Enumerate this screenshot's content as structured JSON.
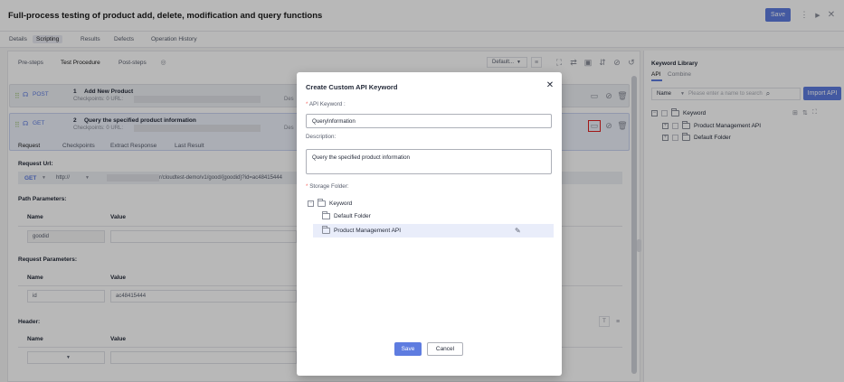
{
  "window": {
    "title": "Full-process testing of product add, delete, modification and query functions",
    "save": "Save"
  },
  "tabs": [
    "Details",
    "Scripting",
    "Results",
    "Defects",
    "Operation History"
  ],
  "subtabs": [
    "Pre-steps",
    "Test Procedure",
    "Post-steps"
  ],
  "toolbar": {
    "env": "Default..."
  },
  "steps": [
    {
      "num": "1",
      "method": "POST",
      "name": "Add New Product",
      "checkpoints": "Checkpoints: 0  URL:",
      "desc": "Des"
    },
    {
      "num": "2",
      "method": "GET",
      "name": "Query the specified product information",
      "checkpoints": "Checkpoints: 0  URL:",
      "desc": "Des"
    }
  ],
  "step_tabs": [
    "Request",
    "Checkpoints",
    "Extract Response",
    "Last Result"
  ],
  "request": {
    "url_label": "Request Url:",
    "method": "GET",
    "protocol": "http://",
    "url": "r/cloudtest-demo/v1/good/{goodid}?id=ac48415444",
    "path_label": "Path Parameters:",
    "name_col": "Name",
    "value_col": "Value",
    "path_name": "goodid",
    "query_label": "Request Parameters:",
    "query_name": "id",
    "query_value": "ac48415444",
    "header_label": "Header:"
  },
  "library": {
    "title": "Keyword Library",
    "tabs": [
      "API",
      "Combine"
    ],
    "filter": "Name",
    "search_placeholder": "Please enter a name to search",
    "import": "Import API",
    "root": "Keyword",
    "items": [
      "Product Management API",
      "Default Folder"
    ]
  },
  "modal": {
    "title": "Create Custom API Keyword",
    "keyword_label": "API Keyword :",
    "keyword_value": "QueryInformation",
    "desc_label": "Description:",
    "desc_value": "Query the specified product information",
    "folder_label": "Storage Folder:",
    "tree": {
      "root": "Keyword",
      "children": [
        "Default Folder",
        "Product Management API"
      ]
    },
    "save": "Save",
    "cancel": "Cancel"
  }
}
